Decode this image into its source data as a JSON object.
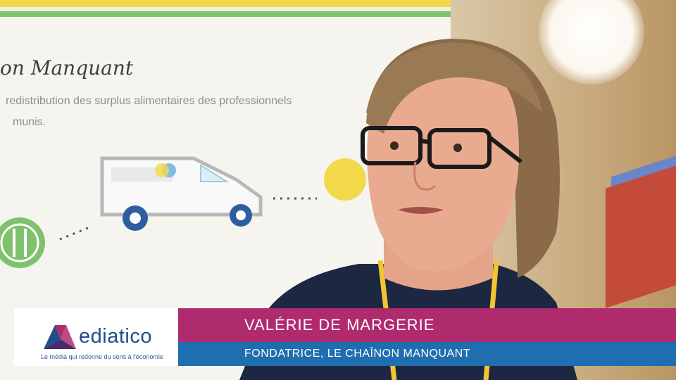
{
  "banner": {
    "title": "on Manquant",
    "line1": "redistribution des surplus alimentaires des professionnels",
    "line2": "munis."
  },
  "lower_third": {
    "brand": "ediatico",
    "tagline": "Le média qui redonne du sens à l'économie",
    "name": "VALÉRIE DE MARGERIE",
    "role": "FONDATRICE, LE CHAÎNON MANQUANT"
  },
  "colors": {
    "name_bar": "#b02a6e",
    "role_bar": "#1f6eb0",
    "brand_blue": "#1f4e8c"
  }
}
